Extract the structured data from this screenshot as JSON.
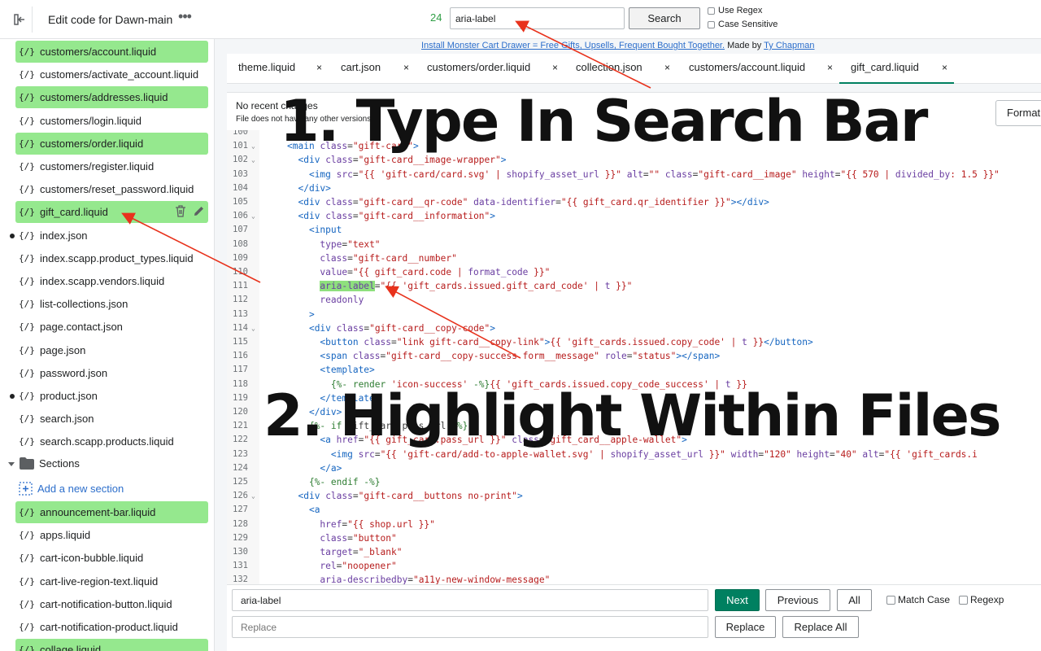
{
  "header": {
    "title": "Edit code for Dawn-main",
    "match_count": "24",
    "search_value": "aria-label",
    "search_label": "Search",
    "use_regex": "Use Regex",
    "case_sensitive": "Case Sensitive",
    "promo_link": "Install Monster Cart Drawer = Free Gifts, Upsells, Frequent Bought Together.",
    "promo_made_by": " Made by ",
    "promo_author": "Ty Chapman"
  },
  "sidebar": {
    "files": [
      {
        "name": "customers/account.liquid",
        "highlighted": true
      },
      {
        "name": "customers/activate_account.liquid",
        "highlighted": false
      },
      {
        "name": "customers/addresses.liquid",
        "highlighted": true
      },
      {
        "name": "customers/login.liquid",
        "highlighted": false
      },
      {
        "name": "customers/order.liquid",
        "highlighted": true
      },
      {
        "name": "customers/register.liquid",
        "highlighted": false
      },
      {
        "name": "customers/reset_password.liquid",
        "highlighted": false
      },
      {
        "name": "gift_card.liquid",
        "highlighted": true
      },
      {
        "name": "index.json",
        "highlighted": false
      },
      {
        "name": "index.scapp.product_types.liquid",
        "highlighted": false
      },
      {
        "name": "index.scapp.vendors.liquid",
        "highlighted": false
      },
      {
        "name": "list-collections.json",
        "highlighted": false
      },
      {
        "name": "page.contact.json",
        "highlighted": false
      },
      {
        "name": "page.json",
        "highlighted": false
      },
      {
        "name": "password.json",
        "highlighted": false
      },
      {
        "name": "product.json",
        "highlighted": false
      },
      {
        "name": "search.json",
        "highlighted": false
      },
      {
        "name": "search.scapp.products.liquid",
        "highlighted": false
      }
    ],
    "file_icon": "{/}",
    "sections_label": "Sections",
    "add_section_label": "Add a new section",
    "section_files": [
      {
        "name": "announcement-bar.liquid",
        "highlighted": true
      },
      {
        "name": "apps.liquid",
        "highlighted": false
      },
      {
        "name": "cart-icon-bubble.liquid",
        "highlighted": false
      },
      {
        "name": "cart-live-region-text.liquid",
        "highlighted": false
      },
      {
        "name": "cart-notification-button.liquid",
        "highlighted": false
      },
      {
        "name": "cart-notification-product.liquid",
        "highlighted": false
      },
      {
        "name": "collage.liquid",
        "highlighted": true
      }
    ]
  },
  "tabs": [
    {
      "label": "theme.liquid"
    },
    {
      "label": "cart.json"
    },
    {
      "label": "customers/order.liquid"
    },
    {
      "label": "collection.json"
    },
    {
      "label": "customers/account.liquid"
    },
    {
      "label": "gift_card.liquid"
    }
  ],
  "tab_close": "×",
  "editor": {
    "revision_title": "No recent changes",
    "revision_sub": "File does not have any other versions",
    "format_label": "Format"
  },
  "code_lines": [
    {
      "n": "100",
      "html": ""
    },
    {
      "n": "101",
      "fold": true,
      "html": "<span class=\"p\">&lt;main</span> <span class=\"a\">class</span>=<span class=\"s\">\"gift-card\"</span><span class=\"p\">&gt;</span>"
    },
    {
      "n": "102",
      "fold": true,
      "html": "  <span class=\"p\">&lt;div</span> <span class=\"a\">class</span>=<span class=\"s\">\"gift-card__image-wrapper\"</span><span class=\"p\">&gt;</span>"
    },
    {
      "n": "103",
      "html": "    <span class=\"p\">&lt;img</span> <span class=\"a\">src</span>=<span class=\"s\">\"{{ 'gift-card/card.svg' | </span><span class=\"f\">shopify_asset_url</span><span class=\"s\"> }}\"</span> <span class=\"a\">alt</span>=<span class=\"s\">\"\"</span> <span class=\"a\">class</span>=<span class=\"s\">\"gift-card__image\"</span> <span class=\"a\">height</span>=<span class=\"s\">\"{{ 570 | </span><span class=\"f\">divided_by</span><span class=\"s\">: 1.5 }}\"</span>"
    },
    {
      "n": "104",
      "html": "  <span class=\"p\">&lt;/div&gt;</span>"
    },
    {
      "n": "105",
      "html": "  <span class=\"p\">&lt;div</span> <span class=\"a\">class</span>=<span class=\"s\">\"gift-card__qr-code\"</span> <span class=\"a\">data-identifier</span>=<span class=\"s\">\"{{ gift_card.qr_identifier }}\"</span><span class=\"p\">&gt;&lt;/div&gt;</span>"
    },
    {
      "n": "106",
      "fold": true,
      "html": "  <span class=\"p\">&lt;div</span> <span class=\"a\">class</span>=<span class=\"s\">\"gift-card__information\"</span><span class=\"p\">&gt;</span>"
    },
    {
      "n": "107",
      "html": "    <span class=\"p\">&lt;input</span>"
    },
    {
      "n": "108",
      "html": "      <span class=\"a\">type</span>=<span class=\"s\">\"text\"</span>"
    },
    {
      "n": "109",
      "html": "      <span class=\"a\">class</span>=<span class=\"s\">\"gift-card__number\"</span>"
    },
    {
      "n": "110",
      "html": "      <span class=\"a\">value</span>=<span class=\"s\">\"{{ gift_card.code | </span><span class=\"f\">format_code</span><span class=\"s\"> }}\"</span>"
    },
    {
      "n": "111",
      "html": "      <span class=\"a mh\">aria-label</span>=<span class=\"s\">\"{{ 'gift_cards.issued.gift_card_code' | </span><span class=\"f\">t</span><span class=\"s\"> }}\"</span>"
    },
    {
      "n": "112",
      "html": "      <span class=\"a\">readonly</span>"
    },
    {
      "n": "113",
      "html": "    <span class=\"p\">&gt;</span>"
    },
    {
      "n": "114",
      "fold": true,
      "html": "    <span class=\"p\">&lt;div</span> <span class=\"a\">class</span>=<span class=\"s\">\"gift-card__copy-code\"</span><span class=\"p\">&gt;</span>"
    },
    {
      "n": "115",
      "html": "      <span class=\"p\">&lt;button</span> <span class=\"a\">class</span>=<span class=\"s\">\"link gift-card__copy-link\"</span><span class=\"p\">&gt;</span><span class=\"s\">{{ 'gift_cards.issued.copy_code' | </span><span class=\"f\">t</span><span class=\"s\"> }}</span><span class=\"p\">&lt;/button&gt;</span>"
    },
    {
      "n": "116",
      "html": "      <span class=\"p\">&lt;span</span> <span class=\"a\">class</span>=<span class=\"s\">\"gift-card__copy-success form__message\"</span> <span class=\"a\">role</span>=<span class=\"s\">\"status\"</span><span class=\"p\">&gt;&lt;/span&gt;</span>"
    },
    {
      "n": "117",
      "html": "      <span class=\"p\">&lt;template&gt;</span>"
    },
    {
      "n": "118",
      "html": "        <span class=\"k\">{%- render</span> <span class=\"s\">'icon-success'</span> <span class=\"k\">-%}</span><span class=\"s\">{{ 'gift_cards.issued.copy_code_success' | </span><span class=\"f\">t</span><span class=\"s\"> }}</span>"
    },
    {
      "n": "119",
      "html": "      <span class=\"p\">&lt;/template&gt;</span>"
    },
    {
      "n": "120",
      "html": "    <span class=\"p\">&lt;/div&gt;</span>"
    },
    {
      "n": "121",
      "html": "    <span class=\"k\">{%- if</span> gift_card.pass_url <span class=\"k\">-%}</span>"
    },
    {
      "n": "122",
      "html": "      <span class=\"p\">&lt;a</span> <span class=\"a\">href</span>=<span class=\"s\">\"{{ gift_card.pass_url }}\"</span> <span class=\"a\">class</span>=<span class=\"s\">\"gift_card__apple-wallet\"</span><span class=\"p\">&gt;</span>"
    },
    {
      "n": "123",
      "html": "        <span class=\"p\">&lt;img</span> <span class=\"a\">src</span>=<span class=\"s\">\"{{ 'gift-card/add-to-apple-wallet.svg' | </span><span class=\"f\">shopify_asset_url</span><span class=\"s\"> }}\"</span> <span class=\"a\">width</span>=<span class=\"s\">\"120\"</span> <span class=\"a\">height</span>=<span class=\"s\">\"40\"</span> <span class=\"a\">alt</span>=<span class=\"s\">\"{{ 'gift_cards.i</span>"
    },
    {
      "n": "124",
      "html": "      <span class=\"p\">&lt;/a&gt;</span>"
    },
    {
      "n": "125",
      "html": "    <span class=\"k\">{%- endif -%}</span>"
    },
    {
      "n": "126",
      "fold": true,
      "html": "  <span class=\"p\">&lt;div</span> <span class=\"a\">class</span>=<span class=\"s\">\"gift-card__buttons no-print\"</span><span class=\"p\">&gt;</span>"
    },
    {
      "n": "127",
      "html": "    <span class=\"p\">&lt;a</span>"
    },
    {
      "n": "128",
      "html": "      <span class=\"a\">href</span>=<span class=\"s\">\"{{ shop.url }}\"</span>"
    },
    {
      "n": "129",
      "html": "      <span class=\"a\">class</span>=<span class=\"s\">\"button\"</span>"
    },
    {
      "n": "130",
      "html": "      <span class=\"a\">target</span>=<span class=\"s\">\"_blank\"</span>"
    },
    {
      "n": "131",
      "html": "      <span class=\"a\">rel</span>=<span class=\"s\">\"noopener\"</span>"
    },
    {
      "n": "132",
      "html": "      <span class=\"a\">aria-describedby</span>=<span class=\"s\">\"a11y-new-window-message\"</span>"
    }
  ],
  "find": {
    "find_value": "aria-label",
    "replace_placeholder": "Replace",
    "next_label": "Next",
    "previous_label": "Previous",
    "all_label": "All",
    "match_case_label": "Match Case",
    "regexp_label": "Regexp",
    "replace_label": "Replace",
    "replace_all_label": "Replace All"
  },
  "annotations": {
    "step1": "1. Type In Search Bar",
    "step2": "2. Highlight Within Files"
  },
  "colors": {
    "highlight": "#95e88e",
    "primary": "#008060",
    "arrow": "#e8321c"
  }
}
